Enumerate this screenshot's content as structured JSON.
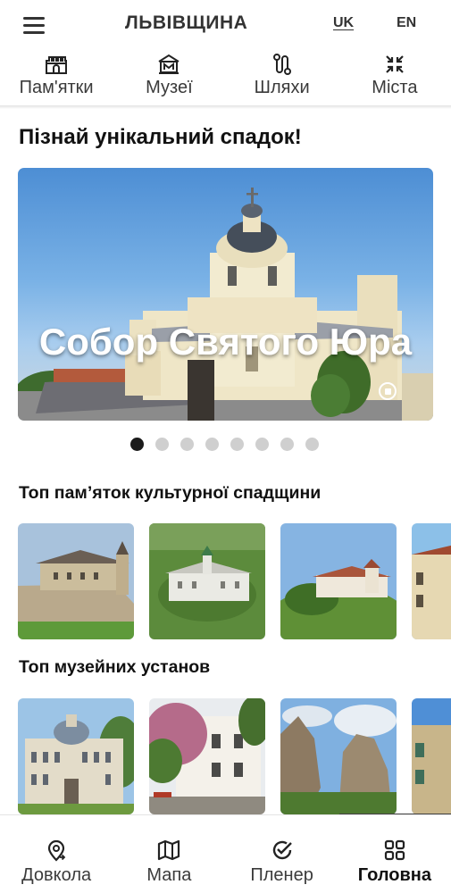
{
  "header": {
    "title": "ЛЬВІВЩИНА",
    "languages": [
      {
        "code": "UK",
        "active": true
      },
      {
        "code": "EN",
        "active": false
      }
    ]
  },
  "categories": [
    {
      "label": "Пам'ятки",
      "icon": "castle-icon"
    },
    {
      "label": "Музеї",
      "icon": "museum-icon"
    },
    {
      "label": "Шляхи",
      "icon": "route-icon"
    },
    {
      "label": "Міста",
      "icon": "city-arrows-icon"
    }
  ],
  "intro": {
    "title": "Пізнай унікальний спадок!"
  },
  "hero": {
    "title": "Собор Святого Юра",
    "slide_count": 8,
    "active_slide": 0
  },
  "sections": {
    "monuments": {
      "title": "Топ пам’яток культурної спадщини"
    },
    "museums": {
      "title": "Топ музейних установ"
    }
  },
  "bottom_nav": [
    {
      "label": "Довкола",
      "icon": "location-pin-icon",
      "active": false
    },
    {
      "label": "Мапа",
      "icon": "map-icon",
      "active": false
    },
    {
      "label": "Пленер",
      "icon": "check-circle-icon",
      "active": false
    },
    {
      "label": "Головна",
      "icon": "grid-icon",
      "active": true
    }
  ],
  "colors": {
    "accent": "#1b1b1b",
    "inactive_dot": "#cfcfcf",
    "sky": "#5d9ddf"
  }
}
